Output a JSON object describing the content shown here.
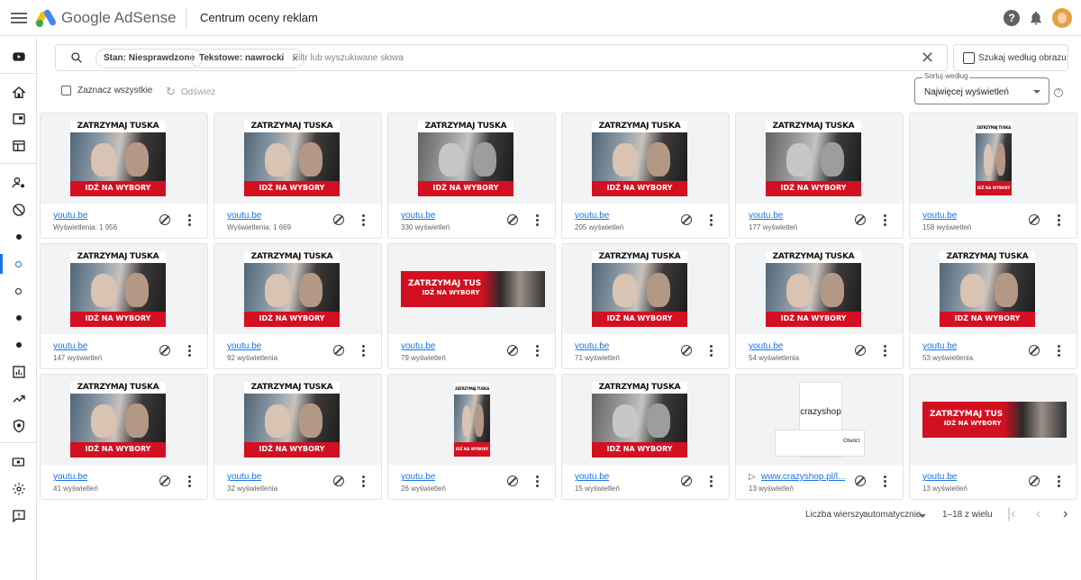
{
  "app": {
    "brand_name": "Google AdSense",
    "page_title": "Centrum oceny reklam"
  },
  "search": {
    "chips": [
      {
        "label": "Stan: Niesprawdzone"
      },
      {
        "label": "Tekstowe: nawrocki"
      }
    ],
    "placeholder": "Filtr lub wyszukiwane słowa",
    "image_search_label": "Szukaj według obrazu"
  },
  "toolbar": {
    "select_all_label": "Zaznacz wszystkie",
    "refresh_label": "Odśwież"
  },
  "sort": {
    "label": "Sortuj według",
    "value": "Najwięcej wyświetleń"
  },
  "ads": [
    {
      "link": "youtu.be",
      "views": "Wyświetlenia: 1 956",
      "art": "square",
      "headline": "ZATRZYMAJ TUSKA",
      "cta": "IDŹ NA WYBORY"
    },
    {
      "link": "youtu.be",
      "views": "Wyświetlenia: 1 669",
      "art": "square",
      "headline": "ZATRZYMAJ TUSKA",
      "cta": "IDŹ NA WYBORY"
    },
    {
      "link": "youtu.be",
      "views": "330 wyświetleń",
      "art": "square-alt",
      "headline": "ZATRZYMAJ TUSKA",
      "cta": "IDŹ NA WYBORY"
    },
    {
      "link": "youtu.be",
      "views": "205 wyświetleń",
      "art": "square",
      "headline": "ZATRZYMAJ TUSKA",
      "cta": "IDŹ NA WYBORY"
    },
    {
      "link": "youtu.be",
      "views": "177 wyświetleń",
      "art": "square-alt",
      "headline": "ZATRZYMAJ TUSKA",
      "cta": "IDŹ NA WYBORY"
    },
    {
      "link": "youtu.be",
      "views": "158 wyświetleń",
      "art": "tall",
      "headline": "ZATRZYMAJ TUSKA",
      "cta": "IDŹ NA WYBORY"
    },
    {
      "link": "youtu.be",
      "views": "147 wyświetleń",
      "art": "square",
      "headline": "ZATRZYMAJ TUSKA",
      "cta": "IDŹ NA WYBORY"
    },
    {
      "link": "youtu.be",
      "views": "92 wyświetlenia",
      "art": "square",
      "headline": "ZATRZYMAJ TUSKA",
      "cta": "IDŹ NA WYBORY"
    },
    {
      "link": "youtu.be",
      "views": "79 wyświetleń",
      "art": "wide",
      "headline": "ZATRZYMAJ TUSKA",
      "cta": "IDŹ NA WYBORY"
    },
    {
      "link": "youtu.be",
      "views": "71 wyświetleń",
      "art": "square",
      "headline": "ZATRZYMAJ TUSKA",
      "cta": "IDŹ NA WYBORY"
    },
    {
      "link": "youtu.be",
      "views": "54 wyświetlenia",
      "art": "square",
      "headline": "ZATRZYMAJ TUSKA",
      "cta": "IDŹ NA WYBORY"
    },
    {
      "link": "youtu.be",
      "views": "53 wyświetlenia",
      "art": "square",
      "headline": "ZATRZYMAJ TUSKA",
      "cta": "IDŹ NA WYBORY"
    },
    {
      "link": "youtu.be",
      "views": "41 wyświetleń",
      "art": "square",
      "headline": "ZATRZYMAJ TUSKA",
      "cta": "IDŹ NA WYBORY"
    },
    {
      "link": "youtu.be",
      "views": "32 wyświetlenia",
      "art": "square",
      "headline": "ZATRZYMAJ TUSKA",
      "cta": "IDŹ NA WYBORY"
    },
    {
      "link": "youtu.be",
      "views": "26 wyświetleń",
      "art": "tall",
      "headline": "ZATRZYMAJ TUSKA",
      "cta": "IDŹ NA WYBORY"
    },
    {
      "link": "youtu.be",
      "views": "15 wyświetleń",
      "art": "square-alt",
      "headline": "ZATRZYMAJ TUSKA",
      "cta": "IDŹ NA WYBORY"
    },
    {
      "link": "www.crazyshop.pl/l...",
      "views": "13 wyświetleń",
      "art": "shop",
      "shop_name": "crazyshop",
      "shop_button": "Otwórz",
      "headline": "",
      "cta": "",
      "link_icon": "play-icon"
    },
    {
      "link": "youtu.be",
      "views": "13 wyświetleń",
      "art": "wide",
      "headline": "ZATRZYMAJ TUSKA",
      "cta": "IDŹ NA WYBORY"
    }
  ],
  "pagination": {
    "rows_label": "Liczba wierszy:",
    "rows_value": "automatycznie",
    "range": "1–18 z wielu"
  },
  "colors": {
    "accent": "#1a73e8",
    "ad_red": "#d31021"
  }
}
